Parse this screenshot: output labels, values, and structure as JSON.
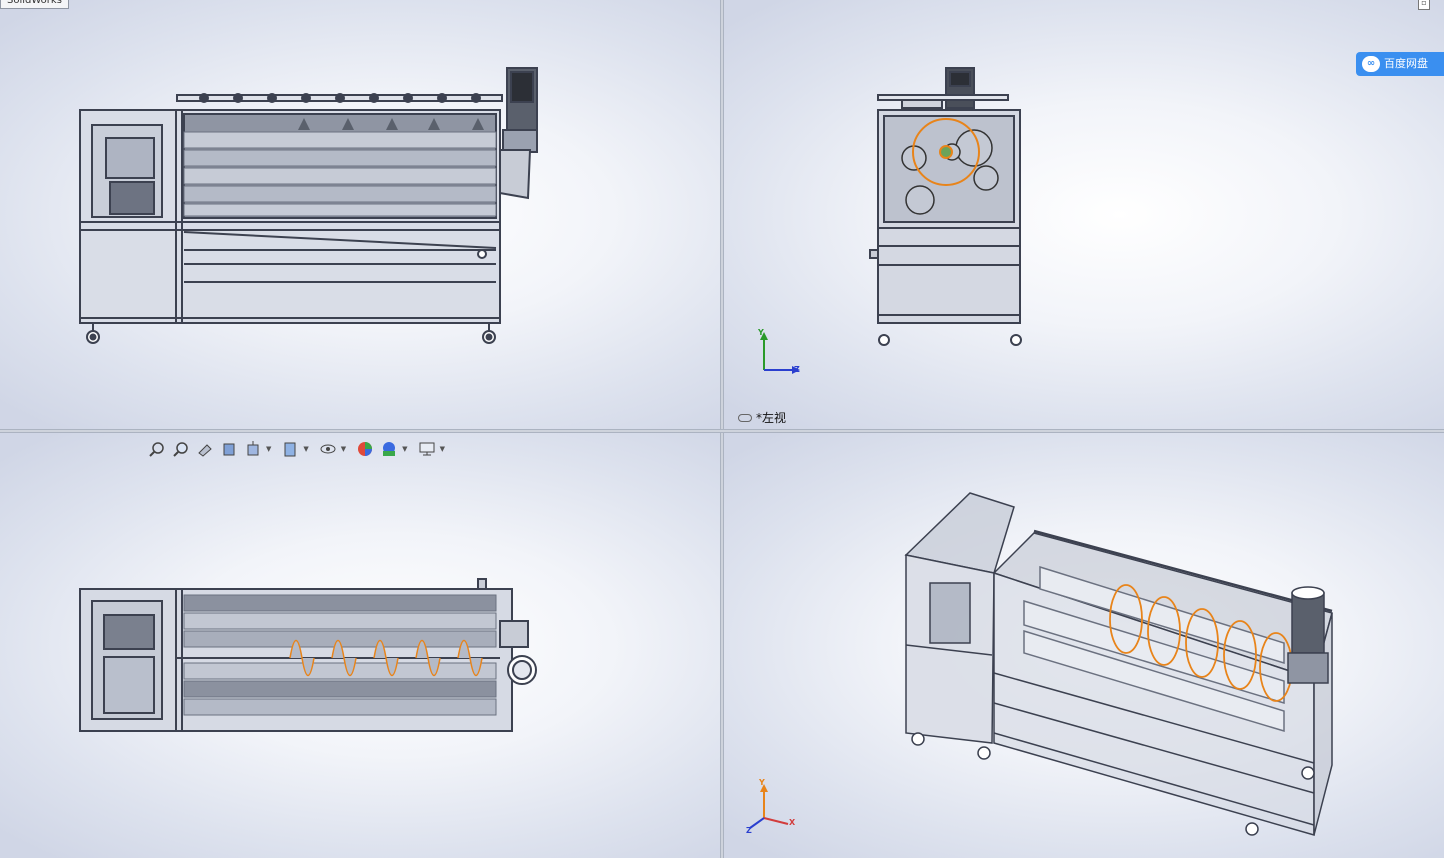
{
  "top_left_tab": {
    "label": "SolidWorks"
  },
  "side_badge": {
    "label": "百度网盘"
  },
  "viewports": {
    "top_right": {
      "view_name": "*左视"
    }
  },
  "triad": {
    "x": "X",
    "y": "Y",
    "z": "Z"
  },
  "heads_up_toolbar": {
    "icons": [
      "zoom-to-fit-icon",
      "zoom-to-area-icon",
      "previous-view-icon",
      "section-view-icon",
      "view-orientation-icon",
      "display-style-icon",
      "hide-show-items-icon",
      "edit-appearance-icon",
      "apply-scene-icon",
      "view-settings-icon"
    ]
  },
  "colors": {
    "accent_orange": "#e8841a",
    "frame": "#3c4150",
    "steel": "#b9c0cf"
  }
}
